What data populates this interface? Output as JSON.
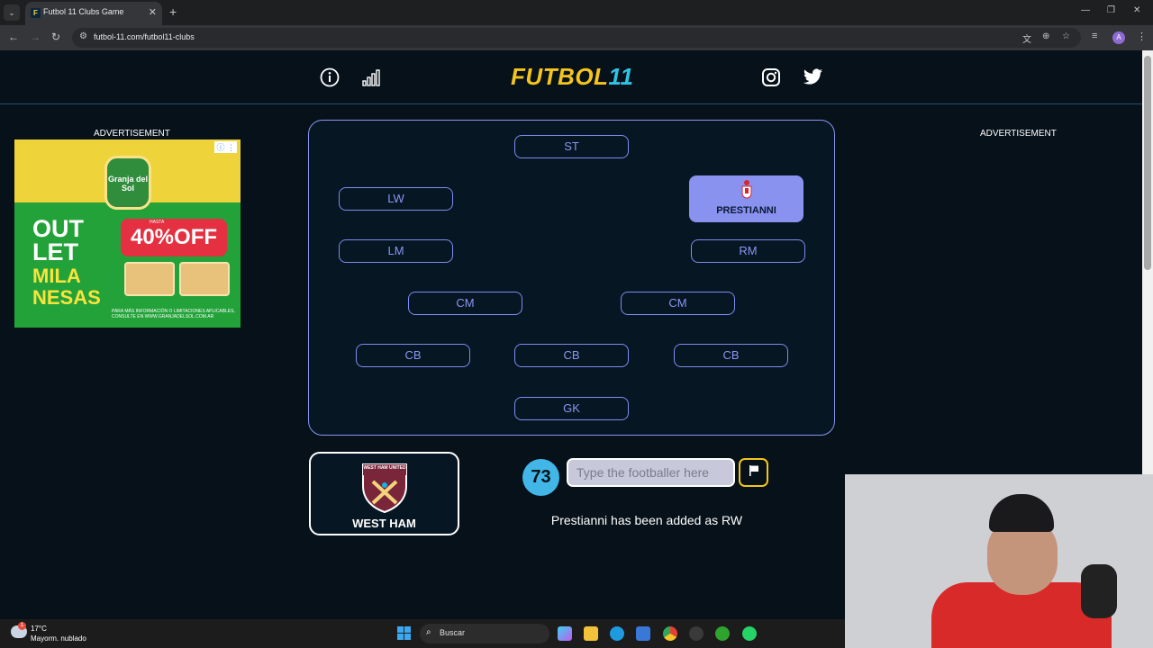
{
  "browser": {
    "tab_title": "Futbol 11 Clubs Game",
    "url": "futbol-11.com/futbol11-clubs",
    "profile_initial": "A"
  },
  "site": {
    "logo_text": "FUTBOL",
    "logo_number": "11",
    "brand_colors": {
      "yellow": "#f5c51c",
      "cyan": "#2ec4e6",
      "pitch_line": "#8a95f0"
    }
  },
  "ads": {
    "left_label": "ADVERTISEMENT",
    "right_label": "ADVERTISEMENT",
    "left_ad": {
      "brand": "Granja del Sol",
      "headline_1": "OUT",
      "headline_2": "LET",
      "headline_3": "MILA",
      "headline_4": "NESAS",
      "discount_prefix": "HASTA",
      "discount": "40%OFF",
      "fine_print": "PARA MÁS INFORMACIÓN O LIMITACIONES APLICABLES, CONSULTE EN WWW.GRANJADELSOL.COM.AR"
    }
  },
  "pitch": {
    "positions": {
      "st": "ST",
      "lw": "LW",
      "rw_player": "PRESTIANNI",
      "lm": "LM",
      "rm": "RM",
      "cm_left": "CM",
      "cm_right": "CM",
      "cb_left": "CB",
      "cb_center": "CB",
      "cb_right": "CB",
      "gk": "GK"
    }
  },
  "club_card": {
    "name": "WEST HAM",
    "crest_text": "WEST HAM UNITED"
  },
  "game": {
    "timer": "73",
    "input_placeholder": "Type the footballer here",
    "status_message": "Prestianni has been added as RW"
  },
  "taskbar": {
    "temperature": "17°C",
    "weather": "Mayorm. nublado",
    "weather_badge": "1",
    "search_placeholder": "Buscar"
  }
}
